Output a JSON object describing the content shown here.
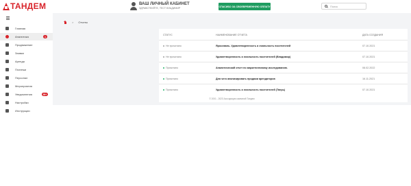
{
  "header": {
    "logo_text": "ТАНДЕМ",
    "cabinet_title": "ВАШ ЛИЧНЫЙ КАБИНЕТ",
    "cabinet_sub": "ЗДРАВСТВУЙТЕ, ТЕСТ ВЛАДИМИР",
    "thanks_button": "СПАСИБО ЗА СВОЕВРЕМЕННУЮ ОПЛАТУ",
    "search_placeholder": "Поиск"
  },
  "sidebar": {
    "items": [
      {
        "label": "Главная",
        "icon": "home-icon"
      },
      {
        "label": "Аналитика",
        "icon": "analytics-icon",
        "badge": "1",
        "active": true
      },
      {
        "label": "Продвижение",
        "icon": "megaphone-icon"
      },
      {
        "label": "Заявки",
        "icon": "mail-icon"
      },
      {
        "label": "Аренда",
        "icon": "hand-icon"
      },
      {
        "label": "Платежи",
        "icon": "payment-icon"
      },
      {
        "label": "Персонал",
        "icon": "people-icon"
      },
      {
        "label": "Мероприятия",
        "icon": "calendar-icon"
      },
      {
        "label": "Уведомления",
        "icon": "bell-icon",
        "badge": "99+"
      },
      {
        "label": "Настройки",
        "icon": "gear-icon"
      },
      {
        "label": "Инструкции",
        "icon": "info-icon"
      }
    ]
  },
  "breadcrumb": {
    "separator": ">",
    "current": "Отчеты"
  },
  "table": {
    "headers": {
      "status": "Статус",
      "name": "Наименование отчета",
      "date": "Дата создания"
    },
    "rows": [
      {
        "status": "Не прочитано",
        "dot_color": "#9e9e9e",
        "name": "Ярославль. Удовлетворенность и лояльность посетителей",
        "date": "07.10.2021"
      },
      {
        "status": "Не прочитано",
        "dot_color": "#9e9e9e",
        "name": "Удовлетворенность и лояльность посетителей (Владимир)",
        "date": "07.10.2021"
      },
      {
        "status": "Прочитано",
        "dot_color": "#26b36b",
        "name": "Аналитический отчет по маркетинговому исследованию.",
        "date": "08.02.2022"
      },
      {
        "status": "Прочитано",
        "dot_color": "#26b36b",
        "name": "Для чего анализировать продажи арендаторов",
        "date": "16.11.2021"
      },
      {
        "status": "Прочитано",
        "dot_color": "#26b36b",
        "name": "Удовлетворенность и лояльность посетителей (Тверь)",
        "date": "07.10.2021"
      }
    ]
  },
  "footer": {
    "text": "© 2001 - 2023 Ассоциация компаний Тандем"
  },
  "colors": {
    "brand": "#d8232a",
    "accent_green": "#1f9c60",
    "read": "#26b36b",
    "unread": "#9e9e9e"
  }
}
